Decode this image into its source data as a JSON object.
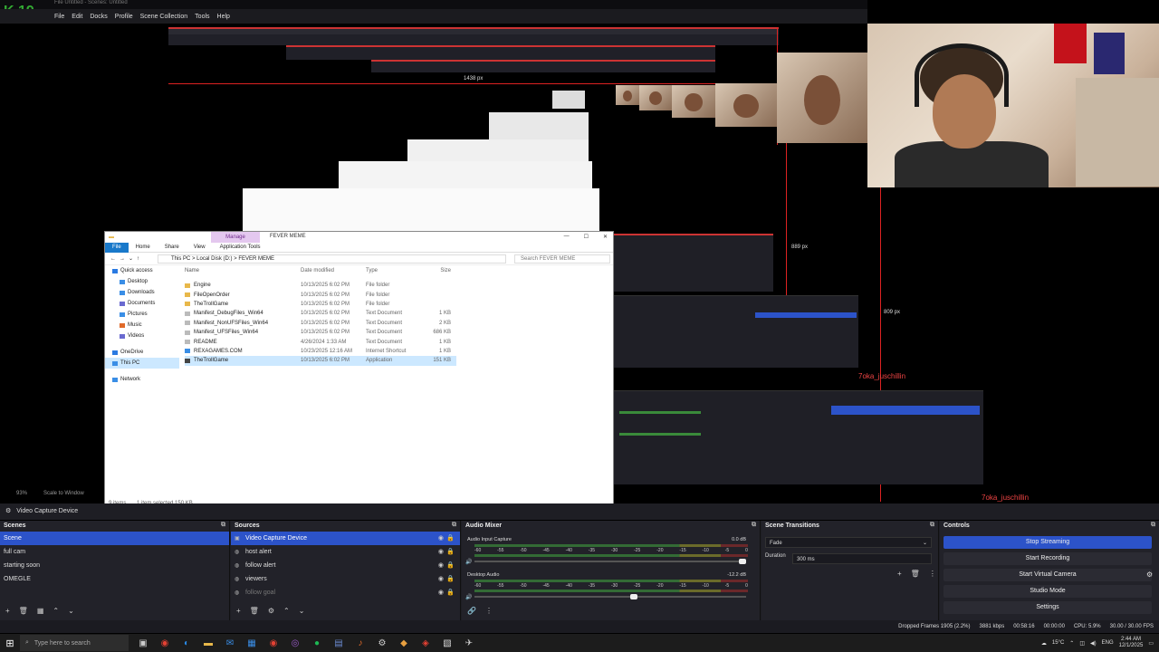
{
  "window": {
    "title_fragment": "File Untitled - Scenes: Untitled",
    "obs_badge": "19",
    "menu": [
      "File",
      "Edit",
      "Docks",
      "Profile",
      "Scene Collection",
      "Tools",
      "Help"
    ]
  },
  "preview": {
    "px_labels": [
      "1438 px",
      "809 px",
      "889 px"
    ],
    "chat_name": "7oka_juschillin",
    "zoom": "93%",
    "scale_label": "Scale to Window",
    "current_source": "Video Capture Device"
  },
  "explorer": {
    "manage": "Manage",
    "title": "FEVER MEME",
    "ribbon": [
      "File",
      "Home",
      "Share",
      "View",
      "Application Tools"
    ],
    "path": "This PC  >  Local Disk (D:)  >  FEVER MEME",
    "search_placeholder": "Search FEVER MEME",
    "nav": [
      {
        "label": "Quick access",
        "icon": "star-icon",
        "color": "#2a7ae2"
      },
      {
        "label": "Desktop",
        "icon": "desktop-icon",
        "color": "#3a8ee6"
      },
      {
        "label": "Downloads",
        "icon": "download-icon",
        "color": "#3a8ee6"
      },
      {
        "label": "Documents",
        "icon": "document-icon",
        "color": "#6a6ad0"
      },
      {
        "label": "Pictures",
        "icon": "picture-icon",
        "color": "#3a8ee6"
      },
      {
        "label": "Music",
        "icon": "music-icon",
        "color": "#e06a2a"
      },
      {
        "label": "Videos",
        "icon": "video-icon",
        "color": "#6a6ad0"
      },
      {
        "label": "OneDrive",
        "icon": "cloud-icon",
        "color": "#2a7ae2"
      },
      {
        "label": "This PC",
        "icon": "computer-icon",
        "color": "#3a8ee6"
      },
      {
        "label": "Network",
        "icon": "network-icon",
        "color": "#3a8ee6"
      }
    ],
    "columns": [
      "Name",
      "Date modified",
      "Type",
      "Size"
    ],
    "files": [
      {
        "name": "Engine",
        "date": "10/13/2025 6:02 PM",
        "type": "File folder",
        "size": "",
        "icon_color": "#e8b84a"
      },
      {
        "name": "FileOpenOrder",
        "date": "10/13/2025 6:02 PM",
        "type": "File folder",
        "size": "",
        "icon_color": "#e8b84a"
      },
      {
        "name": "TheTrollGame",
        "date": "10/13/2025 6:02 PM",
        "type": "File folder",
        "size": "",
        "icon_color": "#e8b84a"
      },
      {
        "name": "Manifest_DebugFiles_Win64",
        "date": "10/13/2025 6:02 PM",
        "type": "Text Document",
        "size": "1 KB",
        "icon_color": "#bbbbbb"
      },
      {
        "name": "Manifest_NonUFSFiles_Win64",
        "date": "10/13/2025 6:02 PM",
        "type": "Text Document",
        "size": "2 KB",
        "icon_color": "#bbbbbb"
      },
      {
        "name": "Manifest_UFSFiles_Win64",
        "date": "10/13/2025 6:02 PM",
        "type": "Text Document",
        "size": "686 KB",
        "icon_color": "#bbbbbb"
      },
      {
        "name": "README",
        "date": "4/26/2024 1:33 AM",
        "type": "Text Document",
        "size": "1 KB",
        "icon_color": "#bbbbbb"
      },
      {
        "name": "REXAGAMES.COM",
        "date": "10/23/2025 12:16 AM",
        "type": "Internet Shortcut",
        "size": "1 KB",
        "icon_color": "#3a8ee6"
      },
      {
        "name": "TheTrollGame",
        "date": "10/13/2025 6:02 PM",
        "type": "Application",
        "size": "151 KB",
        "icon_color": "#444444",
        "selected": true
      }
    ],
    "status_items": "9 items",
    "status_selected": "1 item selected  150 KB"
  },
  "scenes": {
    "title": "Scenes",
    "items": [
      "Scene",
      "full cam",
      "starting soon",
      "OMEGLE"
    ]
  },
  "sources": {
    "title": "Sources",
    "items": [
      {
        "label": "Video Capture Device",
        "icon": "camera-icon"
      },
      {
        "label": "host alert",
        "icon": "globe-icon"
      },
      {
        "label": "follow alert",
        "icon": "globe-icon"
      },
      {
        "label": "viewers",
        "icon": "globe-icon"
      },
      {
        "label": "follow goal",
        "icon": "globe-icon"
      }
    ]
  },
  "mixer": {
    "title": "Audio Mixer",
    "tracks": [
      {
        "name": "Audio Input Capture",
        "db": "0.0 dB",
        "volume": 1.0
      },
      {
        "name": "Desktop Audio",
        "db": "-12.2 dB",
        "volume": 0.6
      }
    ],
    "ticks": [
      "-60",
      "-55",
      "-50",
      "-45",
      "-40",
      "-35",
      "-30",
      "-25",
      "-20",
      "-15",
      "-10",
      "-5",
      "0"
    ]
  },
  "transitions": {
    "title": "Scene Transitions",
    "selected": "Fade",
    "duration_label": "Duration",
    "duration": "300 ms"
  },
  "controls": {
    "title": "Controls",
    "buttons": [
      "Stop Streaming",
      "Start Recording",
      "Start Virtual Camera",
      "Studio Mode",
      "Settings"
    ]
  },
  "status": {
    "dropped": "Dropped Frames 1905 (2.2%)",
    "bitrate": "3881 kbps",
    "stream_time": "00:58:16",
    "rec_time": "00:00:00",
    "cpu": "CPU: 5.9%",
    "fps": "30.00 / 30.00 FPS"
  },
  "taskbar": {
    "search_placeholder": "Type here to search",
    "apps": [
      {
        "icon": "taskview-icon",
        "color": "#cccccc",
        "glyph": "▣"
      },
      {
        "icon": "chrome-icon",
        "color": "#e34133",
        "glyph": "◉"
      },
      {
        "icon": "edge-icon",
        "color": "#2a8ae6",
        "glyph": "◐"
      },
      {
        "icon": "explorer-icon",
        "color": "#e8b84a",
        "glyph": "▬"
      },
      {
        "icon": "mail-icon",
        "color": "#3a8ee6",
        "glyph": "✉"
      },
      {
        "icon": "store-icon",
        "color": "#3a8ee6",
        "glyph": "▦"
      },
      {
        "icon": "chrome2-icon",
        "color": "#e34133",
        "glyph": "◉"
      },
      {
        "icon": "obs-icon",
        "color": "#9a5ac8",
        "glyph": "◎"
      },
      {
        "icon": "spotify-icon",
        "color": "#1db954",
        "glyph": "●"
      },
      {
        "icon": "app-icon",
        "color": "#6a8ad0",
        "glyph": "▤"
      },
      {
        "icon": "mic-icon",
        "color": "#e06a2a",
        "glyph": "♪"
      },
      {
        "icon": "steam-icon",
        "color": "#cccccc",
        "glyph": "⚙"
      },
      {
        "icon": "game-icon",
        "color": "#e8a040",
        "glyph": "◆"
      },
      {
        "icon": "capcut-icon",
        "color": "#e34133",
        "glyph": "◈"
      },
      {
        "icon": "terminal-icon",
        "color": "#dddddd",
        "glyph": "▧"
      },
      {
        "icon": "tool-icon",
        "color": "#cccccc",
        "glyph": "✈"
      }
    ],
    "weather": "15°C",
    "lang": "ENG",
    "time": "2:44 AM",
    "date": "12/1/2025"
  }
}
